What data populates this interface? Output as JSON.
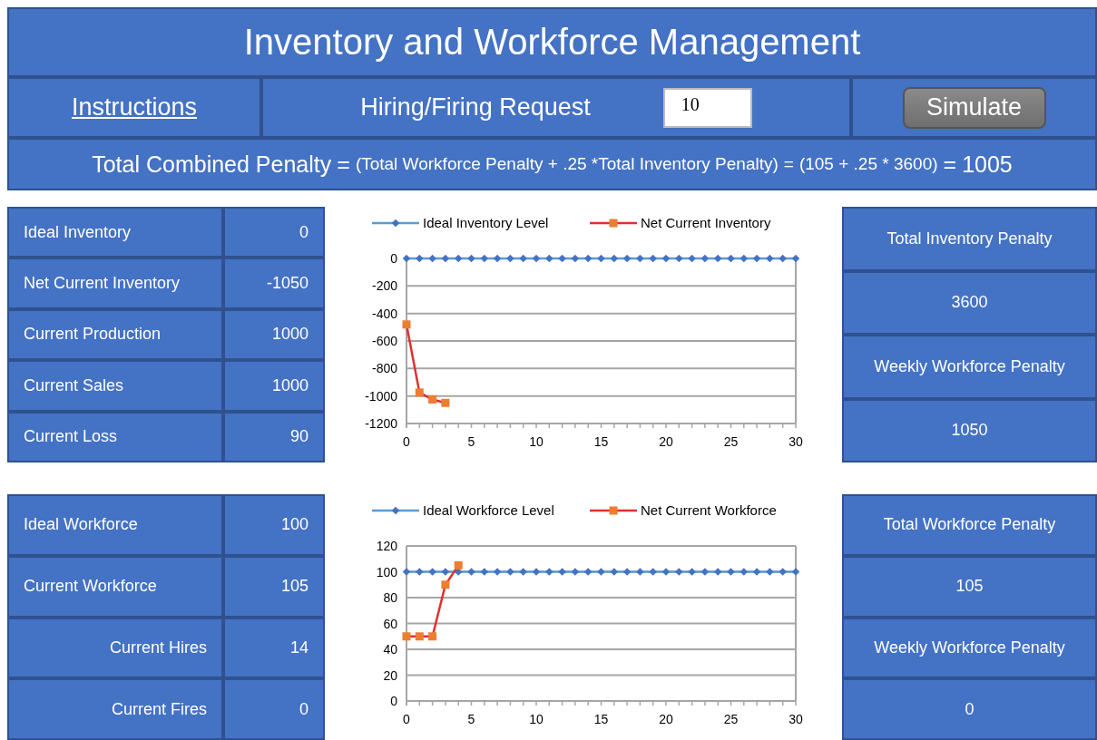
{
  "title": "Inventory and Workforce Management",
  "toolbar": {
    "instructions_link": "Instructions",
    "request_label": "Hiring/Firing Request",
    "request_value": "10",
    "simulate_button": "Simulate"
  },
  "formula": [
    {
      "text": "Total Combined Penalty",
      "kind": "large"
    },
    {
      "text": "=",
      "kind": "large"
    },
    {
      "text": "(Total Workforce Penalty + .25 *Total Inventory Penalty)",
      "kind": "small"
    },
    {
      "text": "=",
      "kind": "small"
    },
    {
      "text": "(105 + .25 * 3600)",
      "kind": "small"
    },
    {
      "text": "=",
      "kind": "large"
    },
    {
      "text": "1005",
      "kind": "large"
    }
  ],
  "sections": [
    {
      "rows": [
        {
          "label": "Ideal Inventory",
          "value": "0",
          "kind": "main"
        },
        {
          "label": "Net Current Inventory",
          "value": "-1050",
          "kind": "main"
        },
        {
          "label": "Current Production",
          "value": "1000",
          "kind": "main"
        },
        {
          "label": "Current Sales",
          "value": "1000",
          "kind": "main"
        },
        {
          "label": "Current Loss",
          "value": "90",
          "kind": "main"
        }
      ],
      "chart_data": {
        "type": "line",
        "x": [
          0,
          1,
          2,
          3,
          4,
          5,
          6,
          7,
          8,
          9,
          10,
          11,
          12,
          13,
          14,
          15,
          16,
          17,
          18,
          19,
          20,
          21,
          22,
          23,
          24,
          25,
          26,
          27,
          28,
          29,
          30
        ],
        "series": [
          {
            "name": "Ideal Inventory Level",
            "color": "#5b9bd5",
            "marker": "diamond",
            "values": [
              0,
              0,
              0,
              0,
              0,
              0,
              0,
              0,
              0,
              0,
              0,
              0,
              0,
              0,
              0,
              0,
              0,
              0,
              0,
              0,
              0,
              0,
              0,
              0,
              0,
              0,
              0,
              0,
              0,
              0,
              0
            ]
          },
          {
            "name": "Net Current Inventory",
            "color": "#e03030",
            "marker": "square",
            "values": [
              -480,
              -975,
              -1025,
              -1050,
              null,
              null,
              null,
              null,
              null,
              null,
              null,
              null,
              null,
              null,
              null,
              null,
              null,
              null,
              null,
              null,
              null,
              null,
              null,
              null,
              null,
              null,
              null,
              null,
              null,
              null,
              null
            ]
          }
        ],
        "grid": true,
        "legend": true,
        "xlim": [
          0,
          30
        ],
        "ylim": [
          -1200,
          0
        ],
        "xticks": [
          {
            "value": 0,
            "label": "0"
          },
          {
            "value": 5,
            "label": "5"
          },
          {
            "value": 10,
            "label": "10"
          },
          {
            "value": 15,
            "label": "15"
          },
          {
            "value": 20,
            "label": "20"
          },
          {
            "value": 25,
            "label": "25"
          },
          {
            "value": 30,
            "label": "30"
          }
        ],
        "yticks": [
          {
            "value": 0,
            "label": "0"
          },
          {
            "value": -200,
            "label": "-200"
          },
          {
            "value": -400,
            "label": "-400"
          },
          {
            "value": -600,
            "label": "-600"
          },
          {
            "value": -800,
            "label": "-800"
          },
          {
            "value": -1000,
            "label": "-1000"
          },
          {
            "value": -1200,
            "label": "-1200"
          }
        ]
      },
      "summary": [
        "Total Inventory Penalty",
        "3600",
        "Weekly Workforce Penalty",
        "1050"
      ]
    },
    {
      "rows": [
        {
          "label": "Ideal Workforce",
          "value": "100",
          "kind": "main"
        },
        {
          "label": "Current Workforce",
          "value": "105",
          "kind": "main"
        },
        {
          "label": "Current Hires",
          "value": "14",
          "kind": "sub"
        },
        {
          "label": "Current Fires",
          "value": "0",
          "kind": "sub"
        }
      ],
      "chart_data": {
        "type": "line",
        "x": [
          0,
          1,
          2,
          3,
          4,
          5,
          6,
          7,
          8,
          9,
          10,
          11,
          12,
          13,
          14,
          15,
          16,
          17,
          18,
          19,
          20,
          21,
          22,
          23,
          24,
          25,
          26,
          27,
          28,
          29,
          30
        ],
        "series": [
          {
            "name": "Ideal Workforce Level",
            "color": "#5b9bd5",
            "marker": "diamond",
            "values": [
              100,
              100,
              100,
              100,
              100,
              100,
              100,
              100,
              100,
              100,
              100,
              100,
              100,
              100,
              100,
              100,
              100,
              100,
              100,
              100,
              100,
              100,
              100,
              100,
              100,
              100,
              100,
              100,
              100,
              100,
              100
            ]
          },
          {
            "name": "Net Current Workforce",
            "color": "#e03030",
            "marker": "square",
            "values": [
              50,
              50,
              50,
              90,
              105,
              null,
              null,
              null,
              null,
              null,
              null,
              null,
              null,
              null,
              null,
              null,
              null,
              null,
              null,
              null,
              null,
              null,
              null,
              null,
              null,
              null,
              null,
              null,
              null,
              null,
              null
            ]
          }
        ],
        "grid": true,
        "legend": true,
        "xlim": [
          0,
          30
        ],
        "ylim": [
          0,
          120
        ],
        "xticks": [
          {
            "value": 0,
            "label": "0"
          },
          {
            "value": 5,
            "label": "5"
          },
          {
            "value": 10,
            "label": "10"
          },
          {
            "value": 15,
            "label": "15"
          },
          {
            "value": 20,
            "label": "20"
          },
          {
            "value": 25,
            "label": "25"
          },
          {
            "value": 30,
            "label": "30"
          }
        ],
        "yticks": [
          {
            "value": 0,
            "label": "0"
          },
          {
            "value": 20,
            "label": "20"
          },
          {
            "value": 40,
            "label": "40"
          },
          {
            "value": 60,
            "label": "60"
          },
          {
            "value": 80,
            "label": "80"
          },
          {
            "value": 100,
            "label": "100"
          },
          {
            "value": 120,
            "label": "120"
          }
        ]
      },
      "summary": [
        "Total Workforce Penalty",
        "105",
        "Weekly Workforce Penalty",
        "0"
      ]
    }
  ]
}
